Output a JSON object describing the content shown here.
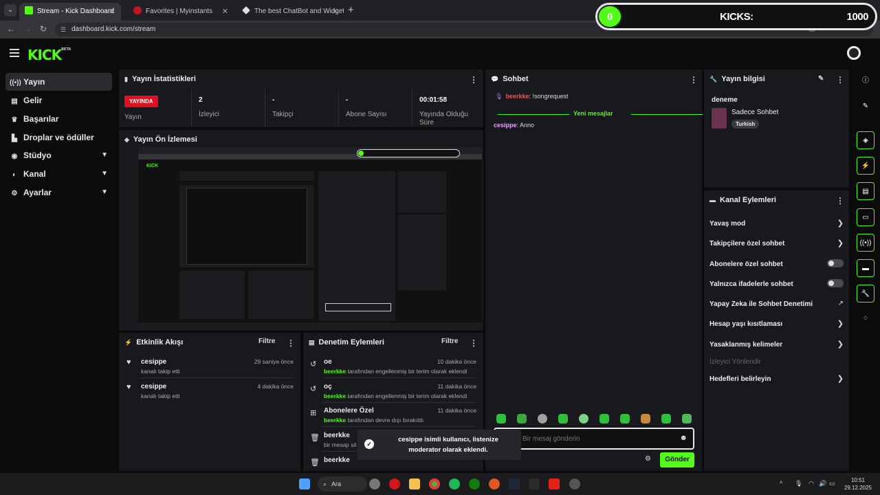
{
  "browser": {
    "tabs": [
      {
        "label": "Stream - Kick Dashboard",
        "active": true
      },
      {
        "label": "Favorites | Myinstants",
        "active": false
      },
      {
        "label": "The best ChatBot and Widgets",
        "active": false
      }
    ],
    "url": "dashboard.kick.com/stream"
  },
  "kicks_overlay": {
    "counter": "0",
    "label": "KICKS:",
    "value": "1000"
  },
  "app": {
    "logo": "KICK",
    "logo_badge": "BETA"
  },
  "sidebar": {
    "items": [
      {
        "label": "Yayın",
        "icon": "broadcast-icon"
      },
      {
        "label": "Gelir",
        "icon": "revenue-icon"
      },
      {
        "label": "Başarılar",
        "icon": "trophy-icon"
      },
      {
        "label": "Droplar ve ödüller",
        "icon": "drops-icon"
      },
      {
        "label": "Stüdyo",
        "icon": "studio-icon"
      },
      {
        "label": "Kanal",
        "icon": "channel-icon"
      },
      {
        "label": "Ayarlar",
        "icon": "settings-icon"
      }
    ]
  },
  "stats": {
    "title": "Yayın İstatistikleri",
    "live_badge": "YAYINDA",
    "live_label": "Yayın",
    "viewers_value": "2",
    "viewers_label": "İzleyici",
    "followers_value": "-",
    "followers_label": "Takipçi",
    "subs_value": "-",
    "subs_label": "Abone Sayısı",
    "uptime_value": "00:01:58",
    "uptime_label": "Yayında Olduğu Süre"
  },
  "preview": {
    "title": "Yayın Ön İzlemesi"
  },
  "activity": {
    "title": "Etkinlik Akışı",
    "filter": "Filtre",
    "items": [
      {
        "name": "cesippe",
        "sub": "kanalı takip etti",
        "time": "29 saniye önce"
      },
      {
        "name": "cesippe",
        "sub": "kanalı takip etti",
        "time": "4 dakika önce"
      }
    ]
  },
  "moderation": {
    "title": "Denetim Eylemleri",
    "filter": "Filtre",
    "items": [
      {
        "name": "oe",
        "actor": "beerkke",
        "sub": "tarafından engellenmiş bir terim olarak eklendi",
        "time": "10 dakika önce"
      },
      {
        "name": "oç",
        "actor": "beerkke",
        "sub": "tarafından engellenmiş bir terim olarak eklendi",
        "time": "11 dakika önce"
      },
      {
        "name": "Abonelere Özel",
        "actor": "beerkke",
        "sub": "tarafından devre dışı bırakıldı",
        "time": "11 dakika önce"
      },
      {
        "name": "beerkke",
        "sub": "bir mesajı sil"
      },
      {
        "name": "beerkke"
      }
    ]
  },
  "chat": {
    "title": "Sohbet",
    "msg1_user": "beerkke",
    "msg1_text": ": !songrequest",
    "new_messages": "Yeni mesajlar",
    "msg2_user": "cesippe",
    "msg2_text": ": Anno",
    "input_placeholder": "Bir mesaj gönderin",
    "send": "Gönder"
  },
  "stream_info": {
    "title": "Yayın bilgisi",
    "stream_title": "deneme",
    "category": "Sadece Sohbet",
    "tag": "Turkish"
  },
  "channel_actions": {
    "title": "Kanal Eylemleri",
    "items": [
      {
        "label": "Yavaş mod",
        "control": "chevron"
      },
      {
        "label": "Takipçilere özel sohbet",
        "control": "chevron"
      },
      {
        "label": "Abonelere özel sohbet",
        "control": "toggle"
      },
      {
        "label": "Yalnızca ifadelerle sohbet",
        "control": "toggle"
      },
      {
        "label": "Yapay Zeka ile Sohbet Denetimi",
        "control": "external"
      },
      {
        "label": "Hesap yaşı kısıtlaması",
        "control": "chevron"
      },
      {
        "label": "Yasaklanmış kelimeler",
        "control": "chevron"
      },
      {
        "label": "İzleyici Yönlendir",
        "control": "none"
      },
      {
        "label": "Hedefleri belirleyin",
        "control": "chevron"
      }
    ]
  },
  "toast": {
    "message": "cesippe isimli kullanıcı, listenize moderator olarak eklendi."
  },
  "taskbar": {
    "search": "Ara",
    "time": "10:51",
    "date": "29.12.2025"
  },
  "colors": {
    "accent": "#53fc18",
    "live": "#e0101e",
    "panel": "#18191c",
    "background": "#0b0b0c"
  }
}
